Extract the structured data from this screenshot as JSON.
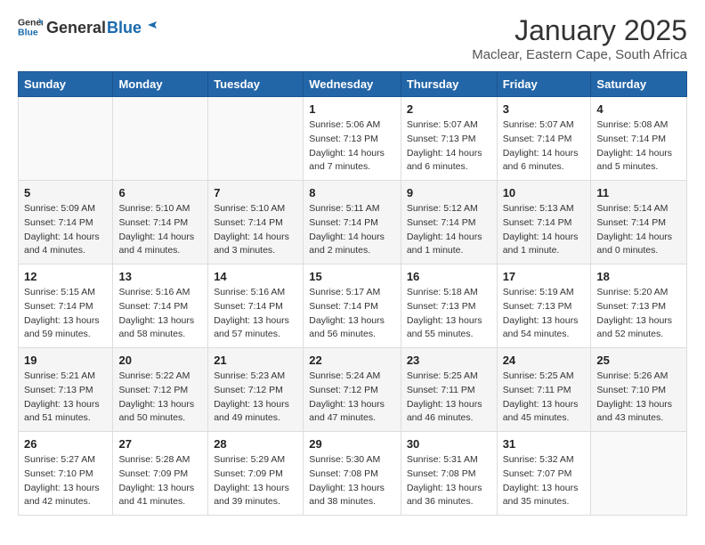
{
  "logo": {
    "text_general": "General",
    "text_blue": "Blue"
  },
  "header": {
    "title": "January 2025",
    "subtitle": "Maclear, Eastern Cape, South Africa"
  },
  "days_of_week": [
    "Sunday",
    "Monday",
    "Tuesday",
    "Wednesday",
    "Thursday",
    "Friday",
    "Saturday"
  ],
  "weeks": [
    [
      {
        "day": "",
        "info": ""
      },
      {
        "day": "",
        "info": ""
      },
      {
        "day": "",
        "info": ""
      },
      {
        "day": "1",
        "info": "Sunrise: 5:06 AM\nSunset: 7:13 PM\nDaylight: 14 hours\nand 7 minutes."
      },
      {
        "day": "2",
        "info": "Sunrise: 5:07 AM\nSunset: 7:13 PM\nDaylight: 14 hours\nand 6 minutes."
      },
      {
        "day": "3",
        "info": "Sunrise: 5:07 AM\nSunset: 7:14 PM\nDaylight: 14 hours\nand 6 minutes."
      },
      {
        "day": "4",
        "info": "Sunrise: 5:08 AM\nSunset: 7:14 PM\nDaylight: 14 hours\nand 5 minutes."
      }
    ],
    [
      {
        "day": "5",
        "info": "Sunrise: 5:09 AM\nSunset: 7:14 PM\nDaylight: 14 hours\nand 4 minutes."
      },
      {
        "day": "6",
        "info": "Sunrise: 5:10 AM\nSunset: 7:14 PM\nDaylight: 14 hours\nand 4 minutes."
      },
      {
        "day": "7",
        "info": "Sunrise: 5:10 AM\nSunset: 7:14 PM\nDaylight: 14 hours\nand 3 minutes."
      },
      {
        "day": "8",
        "info": "Sunrise: 5:11 AM\nSunset: 7:14 PM\nDaylight: 14 hours\nand 2 minutes."
      },
      {
        "day": "9",
        "info": "Sunrise: 5:12 AM\nSunset: 7:14 PM\nDaylight: 14 hours\nand 1 minute."
      },
      {
        "day": "10",
        "info": "Sunrise: 5:13 AM\nSunset: 7:14 PM\nDaylight: 14 hours\nand 1 minute."
      },
      {
        "day": "11",
        "info": "Sunrise: 5:14 AM\nSunset: 7:14 PM\nDaylight: 14 hours\nand 0 minutes."
      }
    ],
    [
      {
        "day": "12",
        "info": "Sunrise: 5:15 AM\nSunset: 7:14 PM\nDaylight: 13 hours\nand 59 minutes."
      },
      {
        "day": "13",
        "info": "Sunrise: 5:16 AM\nSunset: 7:14 PM\nDaylight: 13 hours\nand 58 minutes."
      },
      {
        "day": "14",
        "info": "Sunrise: 5:16 AM\nSunset: 7:14 PM\nDaylight: 13 hours\nand 57 minutes."
      },
      {
        "day": "15",
        "info": "Sunrise: 5:17 AM\nSunset: 7:14 PM\nDaylight: 13 hours\nand 56 minutes."
      },
      {
        "day": "16",
        "info": "Sunrise: 5:18 AM\nSunset: 7:13 PM\nDaylight: 13 hours\nand 55 minutes."
      },
      {
        "day": "17",
        "info": "Sunrise: 5:19 AM\nSunset: 7:13 PM\nDaylight: 13 hours\nand 54 minutes."
      },
      {
        "day": "18",
        "info": "Sunrise: 5:20 AM\nSunset: 7:13 PM\nDaylight: 13 hours\nand 52 minutes."
      }
    ],
    [
      {
        "day": "19",
        "info": "Sunrise: 5:21 AM\nSunset: 7:13 PM\nDaylight: 13 hours\nand 51 minutes."
      },
      {
        "day": "20",
        "info": "Sunrise: 5:22 AM\nSunset: 7:12 PM\nDaylight: 13 hours\nand 50 minutes."
      },
      {
        "day": "21",
        "info": "Sunrise: 5:23 AM\nSunset: 7:12 PM\nDaylight: 13 hours\nand 49 minutes."
      },
      {
        "day": "22",
        "info": "Sunrise: 5:24 AM\nSunset: 7:12 PM\nDaylight: 13 hours\nand 47 minutes."
      },
      {
        "day": "23",
        "info": "Sunrise: 5:25 AM\nSunset: 7:11 PM\nDaylight: 13 hours\nand 46 minutes."
      },
      {
        "day": "24",
        "info": "Sunrise: 5:25 AM\nSunset: 7:11 PM\nDaylight: 13 hours\nand 45 minutes."
      },
      {
        "day": "25",
        "info": "Sunrise: 5:26 AM\nSunset: 7:10 PM\nDaylight: 13 hours\nand 43 minutes."
      }
    ],
    [
      {
        "day": "26",
        "info": "Sunrise: 5:27 AM\nSunset: 7:10 PM\nDaylight: 13 hours\nand 42 minutes."
      },
      {
        "day": "27",
        "info": "Sunrise: 5:28 AM\nSunset: 7:09 PM\nDaylight: 13 hours\nand 41 minutes."
      },
      {
        "day": "28",
        "info": "Sunrise: 5:29 AM\nSunset: 7:09 PM\nDaylight: 13 hours\nand 39 minutes."
      },
      {
        "day": "29",
        "info": "Sunrise: 5:30 AM\nSunset: 7:08 PM\nDaylight: 13 hours\nand 38 minutes."
      },
      {
        "day": "30",
        "info": "Sunrise: 5:31 AM\nSunset: 7:08 PM\nDaylight: 13 hours\nand 36 minutes."
      },
      {
        "day": "31",
        "info": "Sunrise: 5:32 AM\nSunset: 7:07 PM\nDaylight: 13 hours\nand 35 minutes."
      },
      {
        "day": "",
        "info": ""
      }
    ]
  ]
}
